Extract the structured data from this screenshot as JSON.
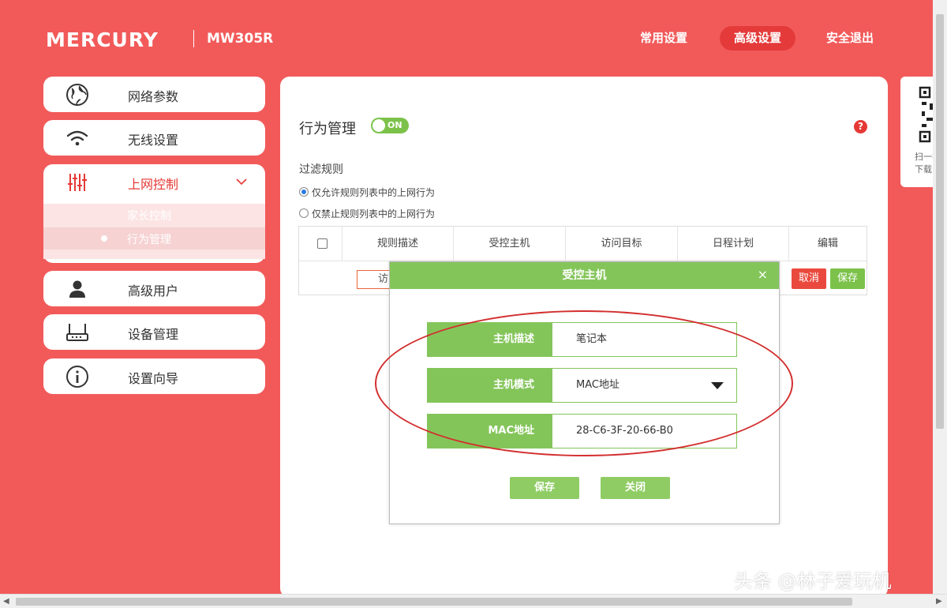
{
  "header": {
    "brand": "MERCURY",
    "model": "MW305R",
    "nav": [
      "常用设置",
      "高级设置",
      "安全退出"
    ],
    "active_nav": "高级设置"
  },
  "sidebar": {
    "items": [
      {
        "label": "网络参数",
        "icon": "globe-icon"
      },
      {
        "label": "无线设置",
        "icon": "wifi-icon"
      },
      {
        "label": "上网控制",
        "icon": "sliders-icon"
      },
      {
        "label": "高级用户",
        "icon": "user-icon"
      },
      {
        "label": "设备管理",
        "icon": "router-icon"
      },
      {
        "label": "设置向导",
        "icon": "info-icon"
      }
    ],
    "sub_items": [
      "家长控制",
      "行为管理"
    ],
    "active_sub": "行为管理"
  },
  "main": {
    "title": "行为管理",
    "toggle": "ON",
    "help": "?",
    "filter_label": "过滤规则",
    "radio_options": [
      {
        "label": "仅允许规则列表中的上网行为",
        "checked": true
      },
      {
        "label": "仅禁止规则列表中的上网行为",
        "checked": false
      }
    ],
    "table_headers": [
      "规则描述",
      "受控主机",
      "访问目标",
      "日程计划",
      "编辑"
    ],
    "row_input": "访",
    "row_buttons": {
      "cancel": "取消",
      "save": "保存"
    }
  },
  "modal": {
    "title": "受控主机",
    "close": "×",
    "fields": [
      {
        "label": "主机描述",
        "value": "笔记本"
      },
      {
        "label": "主机模式",
        "value": "MAC地址"
      },
      {
        "label": "MAC地址",
        "value": "28-C6-3F-20-66-B0"
      }
    ],
    "buttons": {
      "save": "保存",
      "close": "关闭"
    }
  },
  "qr": {
    "text": "扫一扫\n下载"
  },
  "watermark": "头条 @林子爱玩机",
  "colors": {
    "brand": "#f25a5a",
    "accent_green": "#84c55a",
    "accent_red": "#e53935"
  }
}
